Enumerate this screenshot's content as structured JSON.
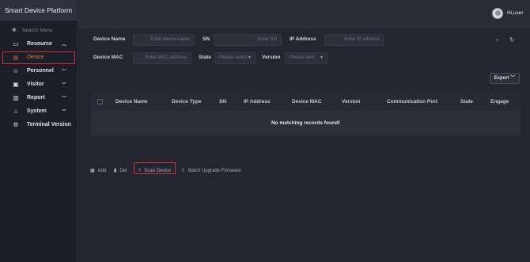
{
  "app": {
    "title": "Smart Device Platform",
    "username": "Hi,user"
  },
  "sidebar": {
    "search_label": "Search Menu",
    "items": [
      {
        "label": "Resource",
        "icon": "folder-icon",
        "expanded": true
      },
      {
        "label": "Device",
        "icon": "device-icon",
        "sub": true,
        "active": true
      },
      {
        "label": "Personnel",
        "icon": "personnel-icon",
        "expanded": false
      },
      {
        "label": "Visitor",
        "icon": "visitor-icon",
        "expanded": false
      },
      {
        "label": "Report",
        "icon": "report-icon",
        "expanded": false
      },
      {
        "label": "System",
        "icon": "system-icon",
        "expanded": false
      },
      {
        "label": "Terminal Version",
        "icon": "terminal-version-icon"
      }
    ]
  },
  "filters": {
    "device_name": {
      "label": "Device Name",
      "placeholder": "Enter device name"
    },
    "sn": {
      "label": "SN",
      "placeholder": "Enter SN"
    },
    "ip_address": {
      "label": "IP Address",
      "placeholder": "Enter IP address"
    },
    "device_mac": {
      "label": "Device MAC",
      "placeholder": "Enter MAC address"
    },
    "state": {
      "label": "State",
      "placeholder": "Please select"
    },
    "version": {
      "label": "Version",
      "placeholder": "Please sele"
    }
  },
  "toolbar": {
    "export_label": "Export",
    "search_icon": "search-icon",
    "refresh_icon": "refresh-icon"
  },
  "table": {
    "columns": [
      "Device Name",
      "Device Type",
      "SN",
      "IP Address",
      "Device MAC",
      "Version",
      "Communication Port",
      "State",
      "Engage"
    ],
    "empty_message": "No matching records found!"
  },
  "actions": {
    "add": "Add",
    "del": "Del",
    "scan": "Scan Device",
    "batch": "Batch Upgrade Firmware"
  },
  "colors": {
    "accent": "#e07a34",
    "highlight_border": "#d12f2f",
    "background": "#232630"
  }
}
